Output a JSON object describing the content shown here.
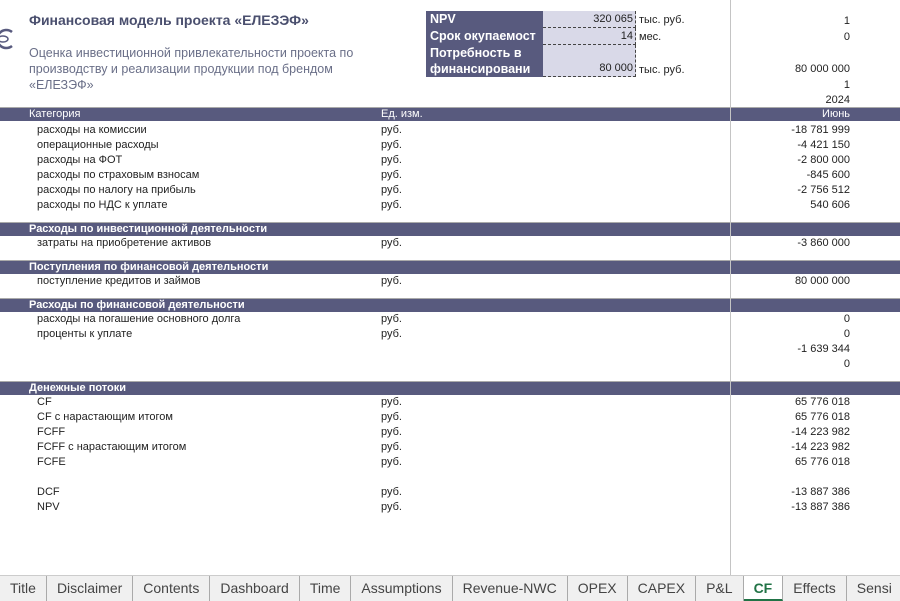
{
  "header": {
    "title": "Финансовая модель проекта «ЕЛЕЗЭФ»",
    "subtitle": "Оценка инвестиционной привлекательности проекта по производству и реализации продукции под брендом «ЕЛЕЗЭФ»"
  },
  "kpi": [
    {
      "label": "NPV",
      "value": "320 065",
      "unit": "тыс. руб."
    },
    {
      "label": "Срок окупаемост",
      "value": "14",
      "unit": "мес."
    },
    {
      "label": "Потребность в финансировани",
      "value": "80 000",
      "unit": "тыс. руб."
    }
  ],
  "top_values": [
    "1",
    "0",
    "80 000 000",
    "1",
    "2024"
  ],
  "table_header": {
    "category": "Категория",
    "unit": "Ед. изм.",
    "month": "Июнь"
  },
  "rows": [
    {
      "label": "расходы на комиссии",
      "unit": "руб.",
      "value": "-18 781 999"
    },
    {
      "label": "операционные расходы",
      "unit": "руб.",
      "value": "-4 421 150"
    },
    {
      "label": "расходы на ФОТ",
      "unit": "руб.",
      "value": "-2 800 000"
    },
    {
      "label": "расходы по страховым взносам",
      "unit": "руб.",
      "value": "-845 600"
    },
    {
      "label": "расходы по налогу на прибыль",
      "unit": "руб.",
      "value": "-2 756 512"
    },
    {
      "label": "расходы по НДС к уплате",
      "unit": "руб.",
      "value": "540 606"
    },
    {
      "section": "Расходы по инвестиционной деятельности"
    },
    {
      "label": "затраты на приобретение активов",
      "unit": "руб.",
      "value": "-3 860 000"
    },
    {
      "section": "Поступления по финансовой деятельности"
    },
    {
      "label": "поступление кредитов и займов",
      "unit": "руб.",
      "value": "80 000 000"
    },
    {
      "section": "Расходы по финансовой деятельности"
    },
    {
      "label": "расходы на погашение основного долга",
      "unit": "руб.",
      "value": "0"
    },
    {
      "label": "проценты к уплате",
      "unit": "руб.",
      "value": "0"
    },
    {
      "label": "",
      "unit": "",
      "value": "-1 639 344"
    },
    {
      "label": "",
      "unit": "",
      "value": "0"
    },
    {
      "section": "Денежные потоки"
    },
    {
      "label": "CF",
      "unit": "руб.",
      "value": "65 776 018"
    },
    {
      "label": "CF с нарастающим итогом",
      "unit": "руб.",
      "value": "65 776 018"
    },
    {
      "label": "FCFF",
      "unit": "руб.",
      "value": "-14 223 982"
    },
    {
      "label": "FCFF с нарастающим итогом",
      "unit": "руб.",
      "value": "-14 223 982"
    },
    {
      "label": "FCFE",
      "unit": "руб.",
      "value": "65 776 018"
    },
    {
      "blank": true
    },
    {
      "label": "DCF",
      "unit": "руб.",
      "value": "-13 887 386"
    },
    {
      "label": "NPV",
      "unit": "руб.",
      "value": "-13 887 386"
    }
  ],
  "sheet_tabs": [
    "Title",
    "Disclaimer",
    "Contents",
    "Dashboard",
    "Time",
    "Assumptions",
    "Revenue-NWC",
    "OPEX",
    "CAPEX",
    "P&L",
    "CF",
    "Effects",
    "Sensi"
  ],
  "active_tab": "CF",
  "colors": {
    "band": "#585a7e",
    "kpi_value_bg": "#d9d9e8",
    "active_tab": "#217346"
  }
}
